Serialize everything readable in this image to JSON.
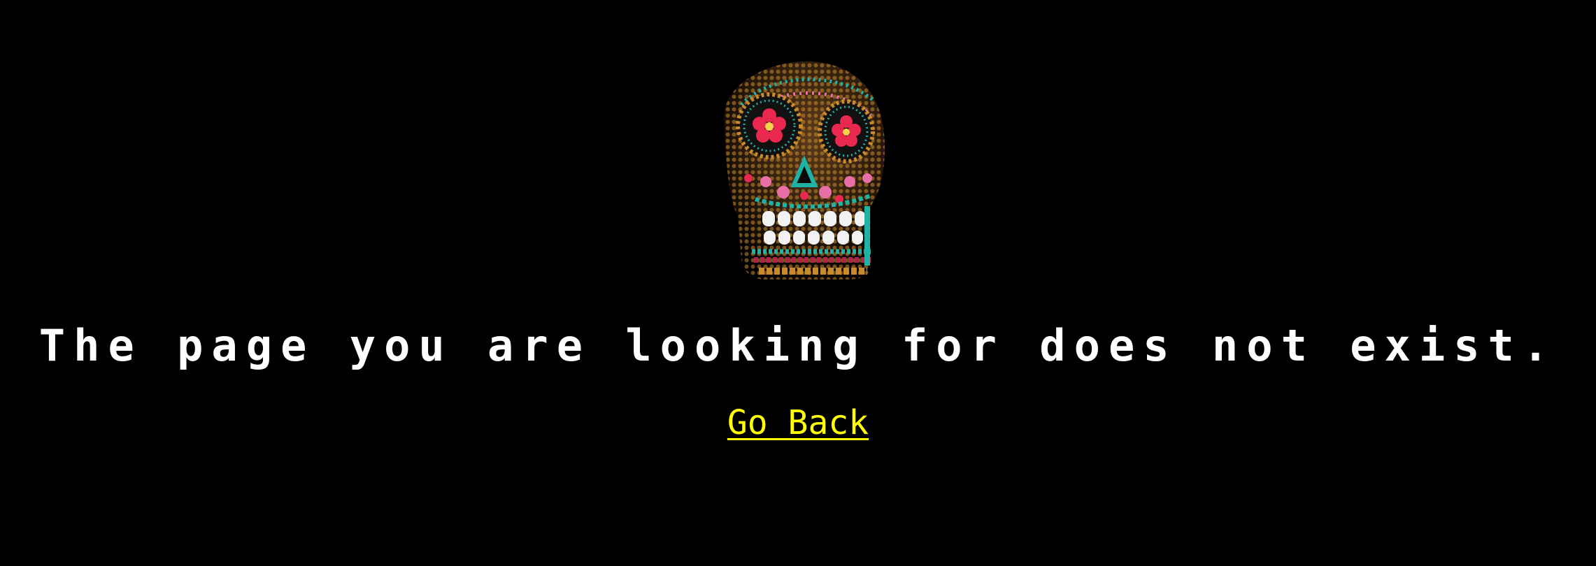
{
  "page": {
    "background_color": "#000000"
  },
  "illustration": {
    "icon": "decorated-sugar-skull-icon",
    "colors": {
      "skull_dots_gold": "#c98a2b",
      "skull_dots_teal": "#1fb3a6",
      "eye_flowers": "#e8284f",
      "teeth": "#f2f2f2",
      "accent_pink": "#e86fa8"
    }
  },
  "message": {
    "text": "The page you are looking for does not exist.",
    "color": "#ffffff"
  },
  "link": {
    "label": "Go Back",
    "color": "#ffff00"
  }
}
